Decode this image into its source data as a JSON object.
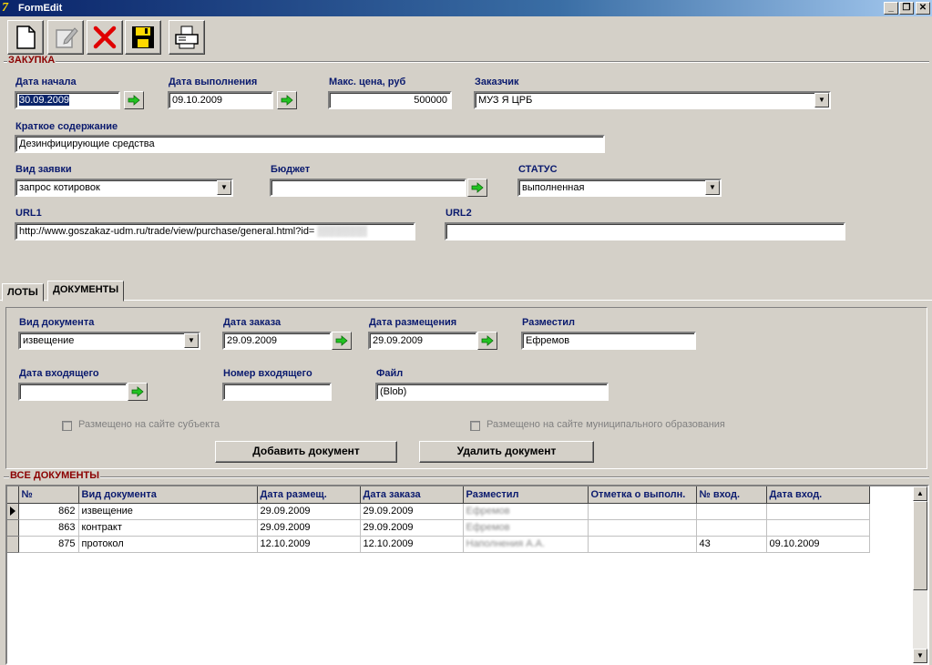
{
  "window": {
    "title": "FormEdit",
    "minimize": "_",
    "restore": "❐",
    "close": "✕"
  },
  "toolbar": {
    "buttons": [
      {
        "name": "new-document-button",
        "icon": "new-page-icon"
      },
      {
        "name": "edit-button",
        "icon": "pencil-icon"
      },
      {
        "name": "delete-button",
        "icon": "red-x-icon"
      },
      {
        "name": "save-button",
        "icon": "floppy-disk-icon"
      },
      {
        "name": "print-button",
        "icon": "printer-icon"
      }
    ]
  },
  "purchase": {
    "group_title": "ЗАКУПКА",
    "start_date_label": "Дата начала",
    "start_date": "30.09.2009",
    "completion_date_label": "Дата выполнения",
    "completion_date": "09.10.2009",
    "max_price_label": "Макс. цена, руб",
    "max_price": "500000",
    "customer_label": "Заказчик",
    "customer_prefix": "МУЗ",
    "customer_suffix": "Я ЦРБ",
    "summary_label": "Краткое содержание",
    "summary": "Дезинфицирующие средства",
    "request_type_label": "Вид заявки",
    "request_type": "запрос котировок",
    "budget_label": "Бюджет",
    "budget": "",
    "status_label": "СТАТУС",
    "status": "выполненная",
    "url1_label": "URL1",
    "url1": "http://www.goszakaz-udm.ru/trade/view/purchase/general.html?id=",
    "url2_label": "URL2",
    "url2": ""
  },
  "tabs": [
    {
      "label": "ЛОТЫ"
    },
    {
      "label": "ДОКУМЕНТЫ"
    }
  ],
  "documents_form": {
    "doc_type_label": "Вид документа",
    "doc_type": "извещение",
    "order_date_label": "Дата заказа",
    "order_date": "29.09.2009",
    "placement_date_label": "Дата размещения",
    "placement_date": "29.09.2009",
    "placed_by_label": "Разместил",
    "placed_by": "Ефремов",
    "incoming_date_label": "Дата входящего",
    "incoming_date": "",
    "incoming_number_label": "Номер входящего",
    "incoming_number": "",
    "file_label": "Файл",
    "file": "(Blob)",
    "chk_subject_label": "Размещено на сайте субъекта",
    "chk_municipal_label": "Размещено на сайте муниципального образования",
    "add_button": "Добавить документ",
    "delete_button": "Удалить документ"
  },
  "all_documents": {
    "group_title": "ВСЕ ДОКУМЕНТЫ",
    "columns": [
      "№",
      "Вид документа",
      "Дата размещ.",
      "Дата заказа",
      "Разместил",
      "Отметка о выполн.",
      "№ вход.",
      "Дата вход."
    ],
    "rows": [
      {
        "num": "862",
        "type": "извещение",
        "placed": "29.09.2009",
        "ordered": "29.09.2009",
        "by": "Ефремов",
        "mark": "",
        "in_num": "",
        "in_date": ""
      },
      {
        "num": "863",
        "type": "контракт",
        "placed": "29.09.2009",
        "ordered": "29.09.2009",
        "by": "Ефремов",
        "mark": "",
        "in_num": "",
        "in_date": ""
      },
      {
        "num": "875",
        "type": "протокол",
        "placed": "12.10.2009",
        "ordered": "12.10.2009",
        "by": "Наполнения А.А.",
        "mark": "",
        "in_num": "43",
        "in_date": "09.10.2009"
      }
    ]
  },
  "colors": {
    "label": "#0a1a6e",
    "group_title": "#8b0000",
    "face": "#d4d0c8",
    "arrow": "#22c322"
  }
}
